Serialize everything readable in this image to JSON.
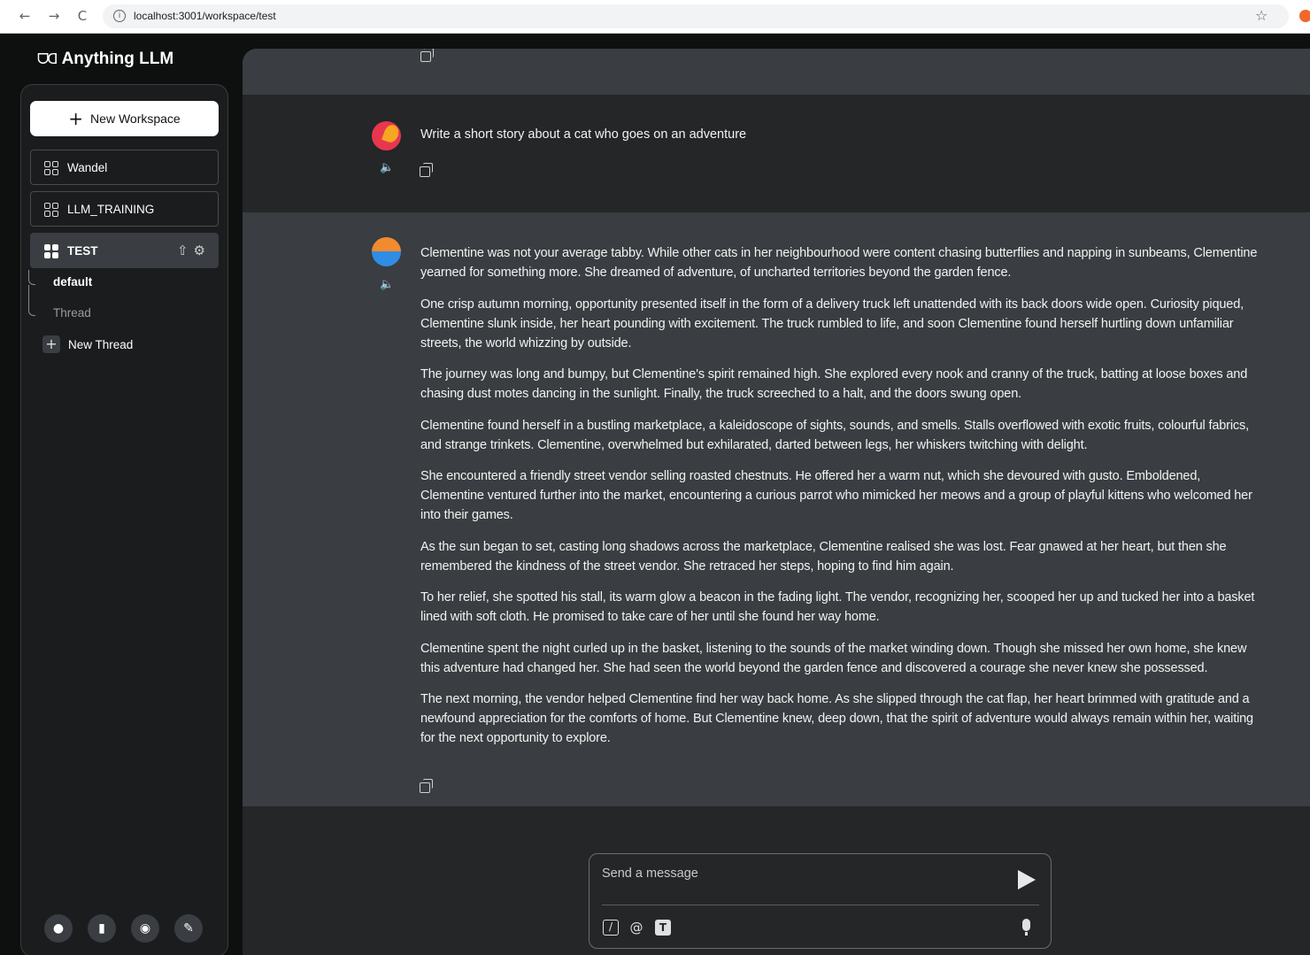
{
  "browser": {
    "url": "localhost:3001/workspace/test",
    "back_icon": "←",
    "forward_icon": "→",
    "reload_icon": "C",
    "info_icon": "i",
    "star_icon": "☆"
  },
  "app": {
    "brand": "Anything LLM",
    "brand_logo": "ᗜᗡ"
  },
  "sidebar": {
    "new_workspace_label": "New Workspace",
    "workspaces": [
      {
        "label": "Wandel",
        "active": false
      },
      {
        "label": "LLM_TRAINING",
        "active": false
      },
      {
        "label": "TEST",
        "active": true
      }
    ],
    "threads": [
      {
        "label": "default",
        "active": true
      },
      {
        "label": "Thread",
        "active": false
      }
    ],
    "new_thread_label": "New Thread",
    "footer_icons": [
      "github-icon",
      "book-icon",
      "discord-icon",
      "wrench-icon"
    ]
  },
  "chat": {
    "user_message": "Write a short story about a cat who goes on an adventure",
    "ai_paragraphs": [
      "Clementine was not your average tabby. While other cats in her neighbourhood were content chasing butterflies and napping in sunbeams, Clementine yearned for something more. She dreamed of adventure, of uncharted territories beyond the garden fence.",
      "One crisp autumn morning, opportunity presented itself in the form of a delivery truck left unattended with its back doors wide open. Curiosity piqued, Clementine slunk inside, her heart pounding with excitement. The truck rumbled to life, and soon Clementine found herself hurtling down unfamiliar streets, the world whizzing by outside.",
      "The journey was long and bumpy, but Clementine's spirit remained high. She explored every nook and cranny of the truck, batting at loose boxes and chasing dust motes dancing in the sunlight. Finally, the truck screeched to a halt, and the doors swung open.",
      "Clementine found herself in a bustling marketplace, a kaleidoscope of sights, sounds, and smells. Stalls overflowed with exotic fruits, colourful fabrics, and strange trinkets. Clementine, overwhelmed but exhilarated, darted between legs, her whiskers twitching with delight.",
      "She encountered a friendly street vendor selling roasted chestnuts. He offered her a warm nut, which she devoured with gusto. Emboldened, Clementine ventured further into the market, encountering a curious parrot who mimicked her meows and a group of playful kittens who welcomed her into their games.",
      "As the sun began to set, casting long shadows across the marketplace, Clementine realised she was lost. Fear gnawed at her heart, but then she remembered the kindness of the street vendor. She retraced her steps, hoping to find him again.",
      "To her relief, she spotted his stall, its warm glow a beacon in the fading light. The vendor, recognizing her, scooped her up and tucked her into a basket lined with soft cloth. He promised to take care of her until she found her way home.",
      "Clementine spent the night curled up in the basket, listening to the sounds of the market winding down. Though she missed her own home, she knew this adventure had changed her. She had seen the world beyond the garden fence and discovered a courage she never knew she possessed.",
      "The next morning, the vendor helped Clementine find her way back home. As she slipped through the cat flap, her heart brimmed with gratitude and a newfound appreciation for the comforts of home. But Clementine knew, deep down, that the spirit of adventure would always remain within her, waiting for the next opportunity to explore."
    ]
  },
  "composer": {
    "placeholder": "Send a message",
    "slash_icon": "/",
    "at_icon": "@",
    "text_icon": "T"
  },
  "icons": {
    "speaker": "🔈",
    "upload": "⇧",
    "gear": "⚙"
  }
}
